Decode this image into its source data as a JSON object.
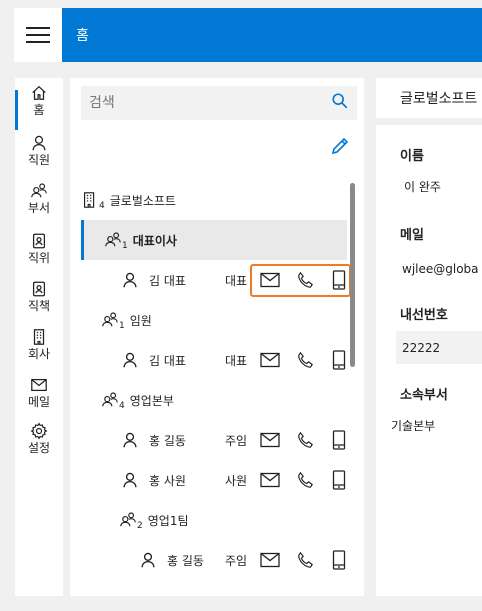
{
  "header": {
    "title": "홈"
  },
  "nav": [
    {
      "label": "홈",
      "icon": "home-icon"
    },
    {
      "label": "직원",
      "icon": "person-icon"
    },
    {
      "label": "부서",
      "icon": "people-icon"
    },
    {
      "label": "직위",
      "icon": "badge-icon"
    },
    {
      "label": "직책",
      "icon": "badge-icon"
    },
    {
      "label": "회사",
      "icon": "building-icon"
    },
    {
      "label": "메일",
      "icon": "mail-icon"
    },
    {
      "label": "설정",
      "icon": "gear-icon"
    }
  ],
  "search": {
    "placeholder": "검색"
  },
  "tree": [
    {
      "type": "company",
      "name": "글로벌소프트",
      "count": "4"
    },
    {
      "type": "dept",
      "name": "대표이사",
      "count": "1",
      "selected": true
    },
    {
      "type": "person",
      "name": "김 대표",
      "rank": "대표"
    },
    {
      "type": "dept",
      "name": "임원",
      "count": "1"
    },
    {
      "type": "person",
      "name": "김 대표",
      "rank": "대표"
    },
    {
      "type": "dept",
      "name": "영업본부",
      "count": "4"
    },
    {
      "type": "person",
      "name": "홍 길동",
      "rank": "주임"
    },
    {
      "type": "person",
      "name": "홍 사원",
      "rank": "사원"
    },
    {
      "type": "dept",
      "name": "영업1팀",
      "count": "2"
    },
    {
      "type": "person",
      "name": "홍 길동",
      "rank": "주임"
    }
  ],
  "detail": {
    "header": "글로벌소프트",
    "name_label": "이름",
    "name_value": "이 완주",
    "mail_label": "메일",
    "mail_value": "wjlee@globa",
    "ext_label": "내선번호",
    "ext_value": "22222",
    "dept_label": "소속부서",
    "dept_value": "기술본부"
  },
  "colors": {
    "accent": "#0078d4",
    "highlight": "#f07b21"
  }
}
